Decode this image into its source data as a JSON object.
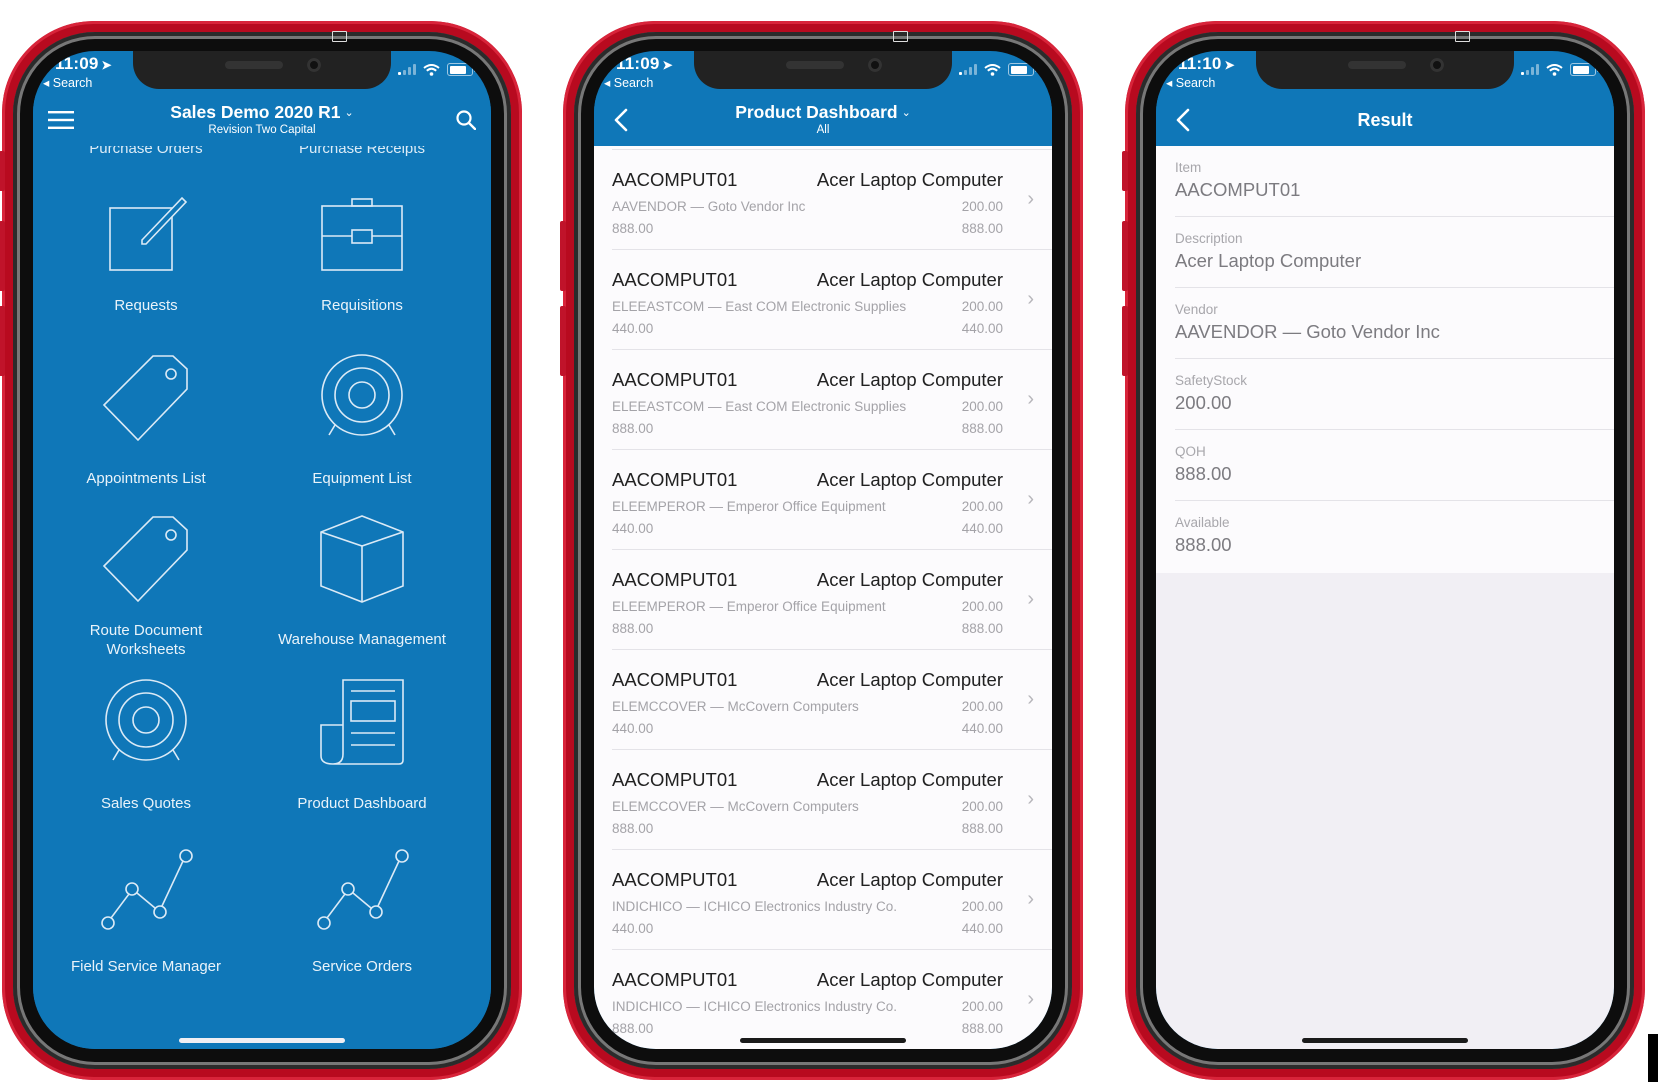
{
  "colors": {
    "brand_blue": "#0f77b8",
    "phone_red": "#b80a1f",
    "list_bg": "#fcfbfd",
    "secondary_text": "#a4a3a8"
  },
  "phones": [
    {
      "status": {
        "time": "11:09",
        "back_app": "Search"
      },
      "nav": {
        "title": "Sales Demo 2020 R1",
        "subtitle": "Revision Two Capital",
        "menu_icon": "hamburger-icon",
        "search_icon": "search-icon"
      },
      "partial_row": [
        "Purchase Orders",
        "Purchase Receipts"
      ],
      "tiles": [
        {
          "label": "Requests",
          "icon": "edit-square-icon"
        },
        {
          "label": "Requisitions",
          "icon": "briefcase-icon"
        },
        {
          "label": "Appointments List",
          "icon": "tag-icon"
        },
        {
          "label": "Equipment List",
          "icon": "target-icon"
        },
        {
          "label": "Route Document Worksheets",
          "label_line1": "Route Document",
          "label_line2": "Worksheets",
          "icon": "tag-icon"
        },
        {
          "label": "Warehouse Management",
          "icon": "cube-icon"
        },
        {
          "label": "Sales Quotes",
          "icon": "target-icon"
        },
        {
          "label": "Product Dashboard",
          "icon": "document-scroll-icon"
        },
        {
          "label": "Field Service Manager",
          "icon": "line-chart-icon"
        },
        {
          "label": "Service Orders",
          "icon": "line-chart-icon"
        }
      ]
    },
    {
      "status": {
        "time": "11:09",
        "back_app": "Search"
      },
      "nav": {
        "title": "Product Dashboard",
        "subtitle": "All"
      },
      "rows": [
        {
          "item": "AACOMPUT01",
          "description": "Acer Laptop Computer",
          "vendor": "AAVENDOR — Goto Vendor Inc",
          "safety_stock": "200.00",
          "qoh": "888.00",
          "available": "888.00"
        },
        {
          "item": "AACOMPUT01",
          "description": "Acer Laptop Computer",
          "vendor": "ELEEASTCOM — East COM Electronic Supplies",
          "safety_stock": "200.00",
          "qoh": "440.00",
          "available": "440.00"
        },
        {
          "item": "AACOMPUT01",
          "description": "Acer Laptop Computer",
          "vendor": "ELEEASTCOM — East COM Electronic Supplies",
          "safety_stock": "200.00",
          "qoh": "888.00",
          "available": "888.00"
        },
        {
          "item": "AACOMPUT01",
          "description": "Acer Laptop Computer",
          "vendor": "ELEEMPEROR — Emperor Office Equipment",
          "safety_stock": "200.00",
          "qoh": "440.00",
          "available": "440.00"
        },
        {
          "item": "AACOMPUT01",
          "description": "Acer Laptop Computer",
          "vendor": "ELEEMPEROR — Emperor Office Equipment",
          "safety_stock": "200.00",
          "qoh": "888.00",
          "available": "888.00"
        },
        {
          "item": "AACOMPUT01",
          "description": "Acer Laptop Computer",
          "vendor": "ELEMCCOVER — McCovern Computers",
          "safety_stock": "200.00",
          "qoh": "440.00",
          "available": "440.00"
        },
        {
          "item": "AACOMPUT01",
          "description": "Acer Laptop Computer",
          "vendor": "ELEMCCOVER — McCovern Computers",
          "safety_stock": "200.00",
          "qoh": "888.00",
          "available": "888.00"
        },
        {
          "item": "AACOMPUT01",
          "description": "Acer Laptop Computer",
          "vendor": "INDICHICO — ICHICO Electronics Industry Co.",
          "safety_stock": "200.00",
          "qoh": "440.00",
          "available": "440.00"
        },
        {
          "item": "AACOMPUT01",
          "description": "Acer Laptop Computer",
          "vendor": "INDICHICO — ICHICO Electronics Industry Co.",
          "safety_stock": "200.00",
          "qoh": "888.00",
          "available": "888.00"
        }
      ]
    },
    {
      "status": {
        "time": "11:10",
        "back_app": "Search"
      },
      "nav": {
        "title": "Result"
      },
      "fields": [
        {
          "label": "Item",
          "value": "AACOMPUT01"
        },
        {
          "label": "Description",
          "value": "Acer Laptop Computer"
        },
        {
          "label": "Vendor",
          "value": "AAVENDOR — Goto Vendor Inc"
        },
        {
          "label": "SafetyStock",
          "value": "200.00"
        },
        {
          "label": "QOH",
          "value": "888.00"
        },
        {
          "label": "Available",
          "value": "888.00"
        }
      ]
    }
  ]
}
